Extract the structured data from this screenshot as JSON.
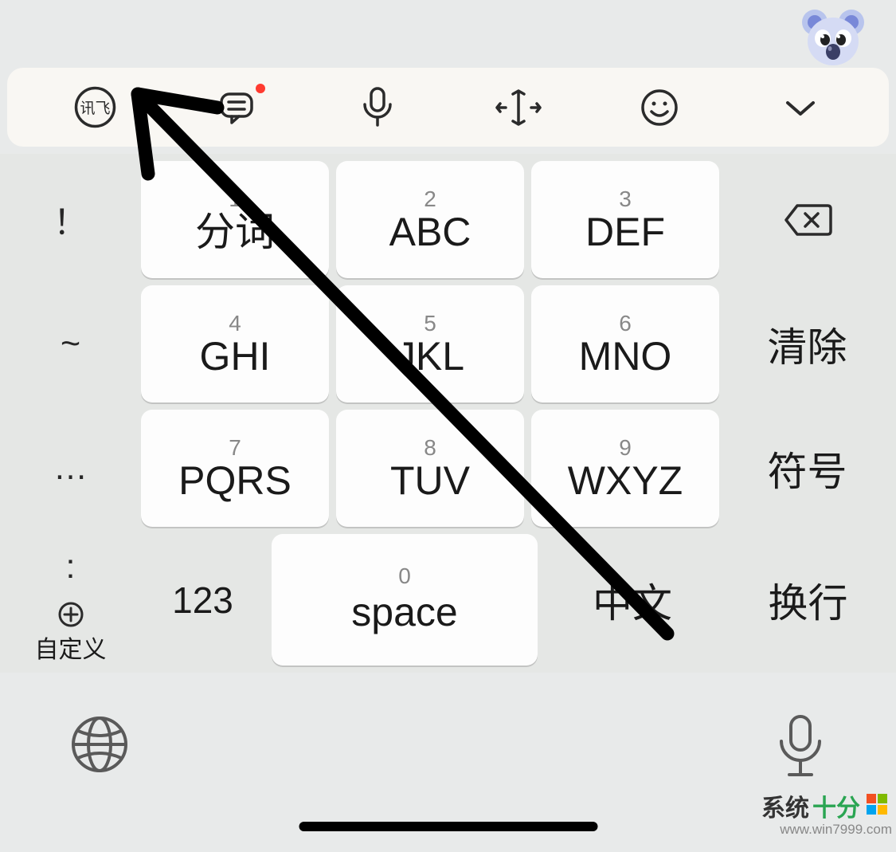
{
  "toolbar": {
    "logo_text": "讯飞",
    "has_message_dot": true
  },
  "side_left": [
    "！",
    "~",
    "…",
    ":"
  ],
  "custom_plus_label": "自定义",
  "keys": {
    "k1": {
      "num": "1",
      "lbl": "分词"
    },
    "k2": {
      "num": "2",
      "lbl": "ABC"
    },
    "k3": {
      "num": "3",
      "lbl": "DEF"
    },
    "k4": {
      "num": "4",
      "lbl": "GHI"
    },
    "k5": {
      "num": "5",
      "lbl": "JKL"
    },
    "k6": {
      "num": "6",
      "lbl": "MNO"
    },
    "k7": {
      "num": "7",
      "lbl": "PQRS"
    },
    "k8": {
      "num": "8",
      "lbl": "TUV"
    },
    "k9": {
      "num": "9",
      "lbl": "WXYZ"
    }
  },
  "right_col": {
    "clear": "清除",
    "symbols": "符号",
    "enter": "换行"
  },
  "bottom_row": {
    "num_switch": "123",
    "space_num": "0",
    "space_lbl": "space",
    "lang": "中文"
  },
  "watermark": {
    "brand": "系统",
    "brand_accent": "十分",
    "url": "www.win7999.com"
  }
}
